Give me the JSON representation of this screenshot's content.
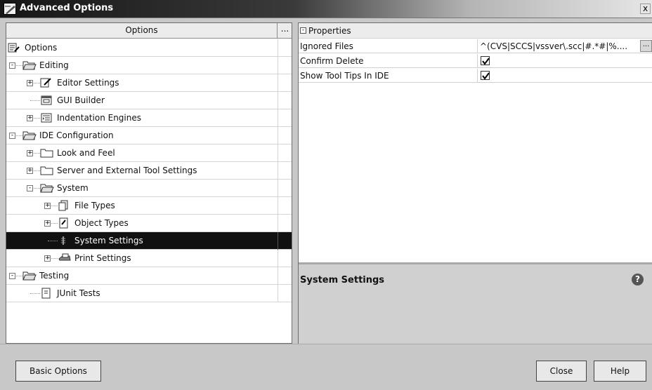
{
  "window": {
    "title": "Advanced Options",
    "close_label": "x"
  },
  "tree": {
    "header": "Options",
    "header_button": "...",
    "items": [
      {
        "label": "Options",
        "icon": "options-icon",
        "expander": ""
      },
      {
        "label": "Editing",
        "icon": "folder-open-icon",
        "expander": "-"
      },
      {
        "label": "Editor Settings",
        "icon": "editor-settings-icon",
        "expander": "+"
      },
      {
        "label": "GUI Builder",
        "icon": "gui-builder-icon",
        "expander": ""
      },
      {
        "label": "Indentation Engines",
        "icon": "indentation-icon",
        "expander": "+"
      },
      {
        "label": "IDE Configuration",
        "icon": "folder-open-icon",
        "expander": "-"
      },
      {
        "label": "Look and Feel",
        "icon": "folder-icon",
        "expander": "+"
      },
      {
        "label": "Server and External Tool Settings",
        "icon": "folder-icon",
        "expander": "+"
      },
      {
        "label": "System",
        "icon": "folder-open-icon",
        "expander": "-"
      },
      {
        "label": "File Types",
        "icon": "file-types-icon",
        "expander": "+"
      },
      {
        "label": "Object Types",
        "icon": "object-types-icon",
        "expander": "+"
      },
      {
        "label": "System Settings",
        "icon": "system-settings-icon",
        "expander": ""
      },
      {
        "label": "Print Settings",
        "icon": "print-icon",
        "expander": "+"
      },
      {
        "label": "Testing",
        "icon": "folder-open-icon",
        "expander": "-"
      },
      {
        "label": "JUnit Tests",
        "icon": "junit-icon",
        "expander": ""
      }
    ]
  },
  "properties": {
    "group_label": "Properties",
    "group_toggle": "-",
    "rows": [
      {
        "name": "Ignored Files",
        "value": "^(CVS|SCCS|vssver\\.scc|#.*#|%...."
      },
      {
        "name": "Confirm Delete",
        "checked": true
      },
      {
        "name": "Show Tool Tips In IDE",
        "checked": true
      }
    ],
    "ellipsis_button": "..."
  },
  "description": {
    "title": "System Settings",
    "help_glyph": "?"
  },
  "buttons": {
    "basic_options": "Basic Options",
    "close": "Close",
    "help": "Help"
  }
}
